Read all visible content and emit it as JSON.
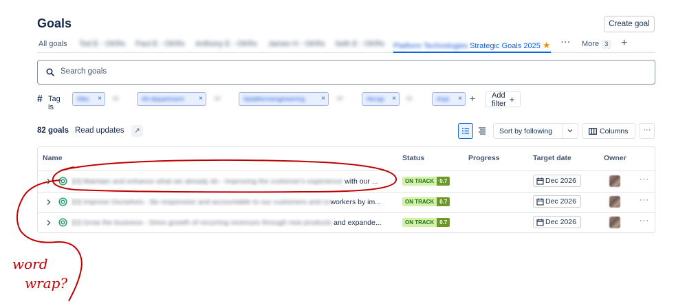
{
  "header": {
    "title": "Goals",
    "create_button": "Create goal"
  },
  "tabs": [
    {
      "label": "All goals",
      "blurred": false
    },
    {
      "label": "Tod E - OKRs",
      "blurred": true
    },
    {
      "label": "Paul E - OKRs",
      "blurred": true
    },
    {
      "label": "Anthony E - OKRs",
      "blurred": true
    },
    {
      "label": "James H - OKRs",
      "blurred": true
    },
    {
      "label": "Seth E - OKRs",
      "blurred": true
    },
    {
      "label": "Platform Technologies Strategic Goals 2025",
      "blurred_prefix": "Platform Technologies",
      "visible_suffix": "Strategic Goals 2025",
      "active": true,
      "starred": true
    }
  ],
  "tab_more": {
    "label": "More",
    "count": "3"
  },
  "search": {
    "placeholder": "Search goals"
  },
  "filters": {
    "tag_label": "Tag",
    "is_label": "is",
    "chips": [
      "#tbc",
      "#it-department",
      "#platformengineering",
      "#ecap",
      "#opi"
    ],
    "operators": [
      "or",
      "or",
      "or",
      "or"
    ],
    "add_filter": "Add filter"
  },
  "summary": {
    "count": "82 goals",
    "read_updates": "Read updates"
  },
  "toolbar": {
    "sort": "Sort by following",
    "columns": "Columns"
  },
  "table": {
    "columns": [
      "Name",
      "Status",
      "Progress",
      "Target date",
      "Owner"
    ],
    "rows": [
      {
        "name_blurred": "[O] Maintain and enhance what we already do - Improving the customer's experience",
        "name_visible": "with our ...",
        "status": "ON TRACK",
        "score": "0.7",
        "target_date": "Dec 2026"
      },
      {
        "name_blurred": "[O] Improve Ourselves - Be responsive and accountable to our customers and co",
        "name_visible": "workers by im...",
        "status": "ON TRACK",
        "score": "0.7",
        "target_date": "Dec 2026"
      },
      {
        "name_blurred": "[O] Grow the business - Drive growth of recurring revenues through new products",
        "name_visible": "and expande...",
        "status": "ON TRACK",
        "score": "0.7",
        "target_date": "Dec 2026"
      }
    ]
  },
  "annotation": {
    "line1": "word",
    "line2": "wrap?",
    "color": "#c00000"
  },
  "colors": {
    "accent": "#0c66e4",
    "on_track_bg": "#d3f1a7",
    "score_bg": "#6a9a23",
    "star": "#f18d13"
  }
}
